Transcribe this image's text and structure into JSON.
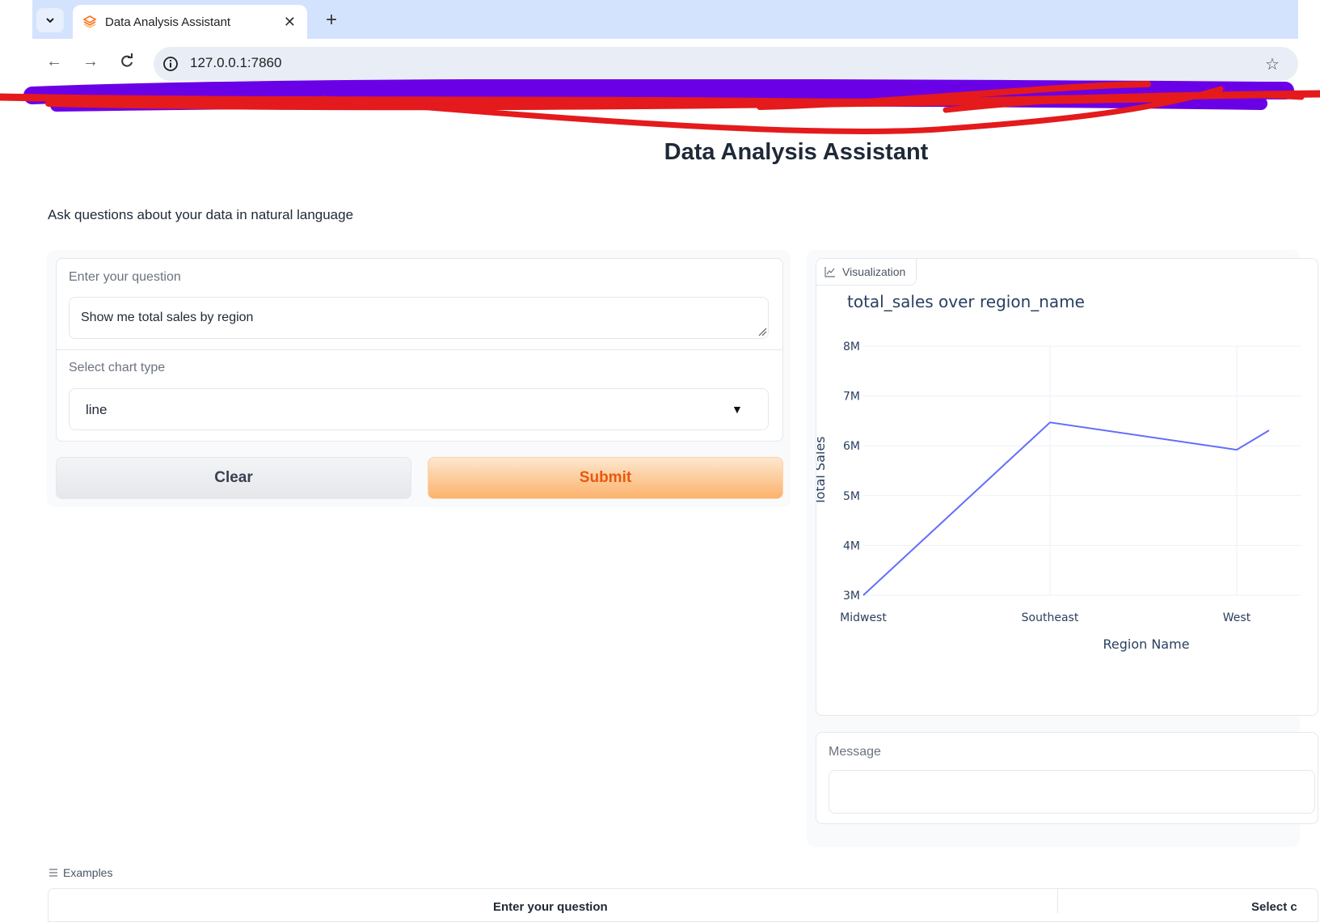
{
  "browser": {
    "tab_title": "Data Analysis Assistant",
    "url": "127.0.0.1:7860"
  },
  "app": {
    "title": "Data Analysis Assistant",
    "description": "Ask questions about your data in natural language"
  },
  "form": {
    "question_label": "Enter your question",
    "question_value": "Show me total sales by region",
    "chart_type_label": "Select chart type",
    "chart_type_value": "line",
    "clear_label": "Clear",
    "submit_label": "Submit"
  },
  "visualization": {
    "chip_label": "Visualization"
  },
  "message": {
    "label": "Message",
    "value": ""
  },
  "examples": {
    "label": "Examples",
    "columns": [
      "Enter your question",
      "Select c"
    ]
  },
  "chart_data": {
    "type": "line",
    "title": "total_sales over region_name",
    "xlabel": "Region Name",
    "ylabel": "Total Sales",
    "categories": [
      "Midwest",
      "Southeast",
      "West"
    ],
    "values": [
      3000000,
      6470000,
      5920000
    ],
    "ylim": [
      3000000,
      8000000
    ],
    "yticks": [
      3000000,
      4000000,
      5000000,
      6000000,
      7000000,
      8000000
    ],
    "ytick_labels": [
      "3M",
      "4M",
      "5M",
      "6M",
      "7M",
      "8M"
    ],
    "grid": true,
    "line_color": "#636efa"
  }
}
